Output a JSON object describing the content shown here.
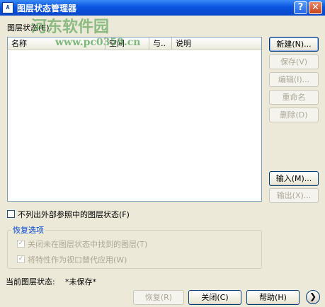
{
  "window": {
    "title": "图层状态管理器",
    "icon_text": "A",
    "help_glyph": "?",
    "close_glyph": "✕"
  },
  "states_label": "图层状态(E)",
  "list": {
    "columns": [
      "名称",
      "空间",
      "与..",
      "说明"
    ]
  },
  "buttons": {
    "new": "新建(N)...",
    "save": "保存(V)",
    "edit": "编辑(I)...",
    "rename": "重命名",
    "delete": "删除(D)",
    "import": "输入(M)...",
    "export": "输出(X)..."
  },
  "exclude_xref": {
    "label": "不列出外部参照中的图层状态(F)",
    "checked": false
  },
  "restore_options": {
    "title": "恢复选项",
    "turn_off_layers": "关闭未在图层状态中找到的图层(T)",
    "apply_as_overrides": "将特性作为视口替代应用(W)",
    "check_glyph": "✓"
  },
  "current_state": {
    "label": "当前图层状态:",
    "value": "*未保存*"
  },
  "bottom_buttons": {
    "restore": "恢复(R)",
    "close": "关闭(C)",
    "help": "帮助(H)",
    "more_glyph": "❯"
  },
  "watermark": {
    "brand": "河东软件园",
    "url": "www.pc0359.cn"
  }
}
